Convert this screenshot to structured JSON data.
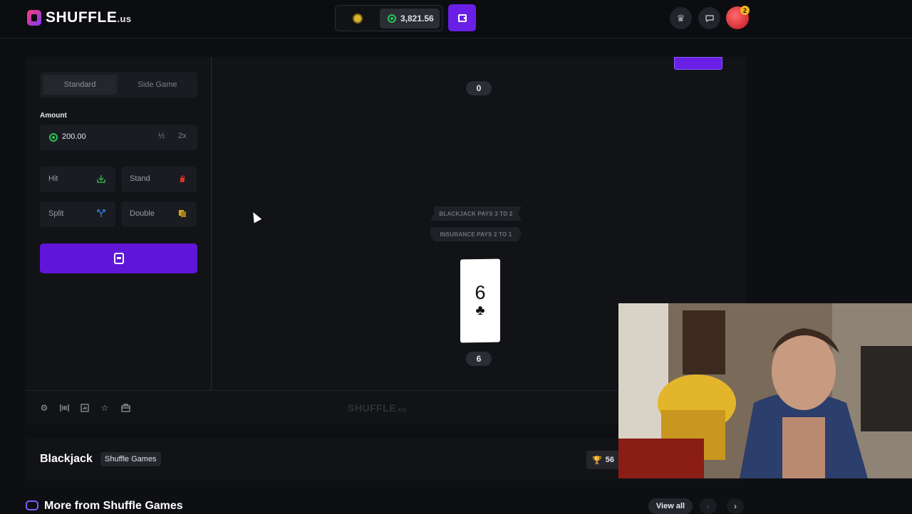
{
  "header": {
    "logo_text": "SHUFFLE",
    "logo_suffix": ".us",
    "balance": "3,821.56",
    "notification_count": "2"
  },
  "sidebar": {
    "tabs": [
      {
        "label": "Standard",
        "active": true
      },
      {
        "label": "Side Game",
        "active": false
      }
    ],
    "amount_label": "Amount",
    "amount_value": "200.00",
    "half_label": "½",
    "double_label": "2x",
    "actions": [
      {
        "label": "Hit",
        "icon": "hit-icon",
        "color": "#2fb34d"
      },
      {
        "label": "Stand",
        "icon": "hand-icon",
        "color": "#d9342b"
      },
      {
        "label": "Split",
        "icon": "split-icon",
        "color": "#2f7fd9"
      },
      {
        "label": "Double",
        "icon": "double-icon",
        "color": "#d7a628"
      }
    ]
  },
  "table": {
    "dealer_score": "0",
    "player_score": "6",
    "ribbon_top": "BLACKJACK PAYS 3 TO 2",
    "ribbon_bottom": "INSURANCE PAYS 2 TO 1",
    "card": {
      "rank": "6",
      "suit": "♣"
    }
  },
  "footer": {
    "watermark": "SHUFFLE",
    "watermark_suffix": ".us"
  },
  "info": {
    "game_title": "Blackjack",
    "provider": "Shuffle Games",
    "trophy_count": "56"
  },
  "more": {
    "title": "More from Shuffle Games",
    "view_all": "View all"
  },
  "colors": {
    "accent": "#6a1fe6",
    "background": "#0e0f12",
    "panel": "#121317"
  }
}
